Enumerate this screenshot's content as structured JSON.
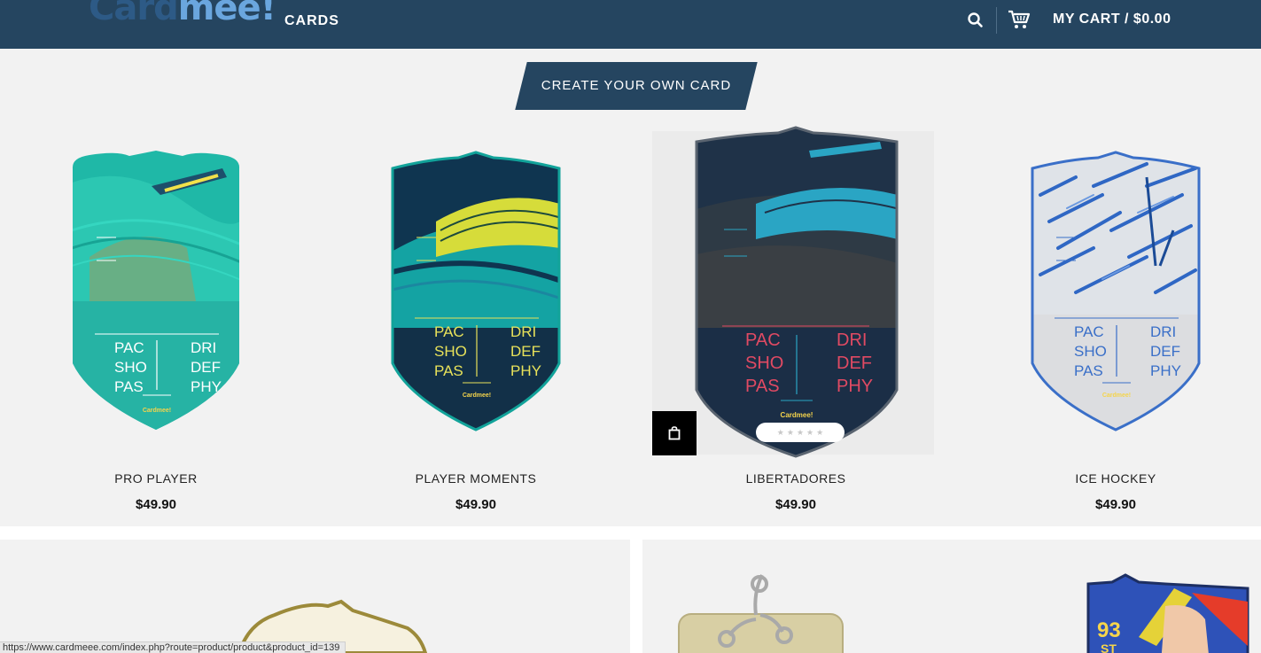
{
  "header": {
    "logo_part1": "Card",
    "logo_part2": "mee!",
    "nav_cards": "CARDS",
    "cart_label": "MY CART / $0.00"
  },
  "cta": {
    "label": "CREATE YOUR OWN CARD"
  },
  "card_stats": {
    "left": [
      "PAC",
      "SHO",
      "PAS"
    ],
    "right": [
      "DRI",
      "DEF",
      "PHY"
    ],
    "brand": "Cardmee!"
  },
  "products": [
    {
      "name": "PRO PLAYER",
      "price": "$49.90"
    },
    {
      "name": "PLAYER MOMENTS",
      "price": "$49.90"
    },
    {
      "name": "LIBERTADORES",
      "price": "$49.90"
    },
    {
      "name": "ICE HOCKEY",
      "price": "$49.90"
    }
  ],
  "rating": {
    "stars": 5,
    "filled": 0,
    "star_glyph": "★"
  },
  "promo_card": {
    "rating": "93",
    "position": "ST"
  },
  "status_bar": {
    "url": "https://www.cardmeee.com/index.php?route=product/product&product_id=139"
  },
  "colors": {
    "header_bg": "#254560",
    "page_bg": "#f2f2f2",
    "cta_bg": "#254560"
  }
}
